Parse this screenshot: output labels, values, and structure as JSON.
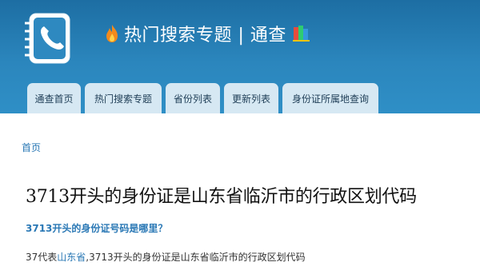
{
  "header": {
    "title": "热门搜索专题 | 通查",
    "logo_icon": "phone-book-icon",
    "flame_icon": "flame-icon",
    "books_icon": "books-icon",
    "background_color": "#2b86bd"
  },
  "nav": {
    "tabs": [
      {
        "label": "通查首页"
      },
      {
        "label": "热门搜索专题"
      },
      {
        "label": "省份列表"
      },
      {
        "label": "更新列表"
      },
      {
        "label": "身份证所属地查询"
      }
    ]
  },
  "breadcrumb": {
    "home": "首页"
  },
  "article": {
    "title": "3713开头的身份证是山东省临沂市的行政区划代码",
    "question": "3713开头的身份证号码是哪里？",
    "body_prefix": "37代表",
    "body_link": "山东省",
    "body_suffix": ",3713开头的身份证是山东省临沂市的行政区划代码"
  },
  "colors": {
    "link": "#2a78b5",
    "tab_background": "#d6e8f3"
  }
}
